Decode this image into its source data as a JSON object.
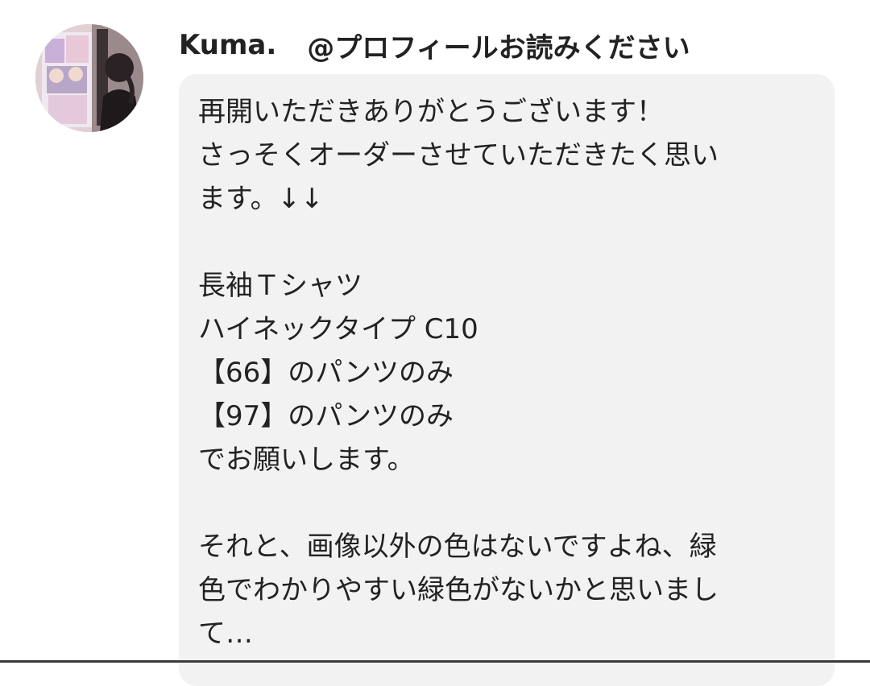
{
  "comment": {
    "user_name": "Kuma.",
    "user_handle": "@プロフィールお読みください",
    "message_lines": [
      "再開いただきありがとうございます！",
      "さっそくオーダーさせていただきたく思い",
      "ます。↓↓",
      "",
      "長袖Ｔシャツ",
      "ハイネックタイプ C10",
      "【66】のパンツのみ",
      "【97】のパンツのみ",
      "でお願いします。",
      "",
      "それと、画像以外の色はないですよね、緑",
      "色でわかりやすい緑色がないかと思いまし",
      "て…"
    ]
  },
  "colors": {
    "bubble_background": "#f2f2f2",
    "text": "#222222",
    "page_background": "#ffffff"
  }
}
